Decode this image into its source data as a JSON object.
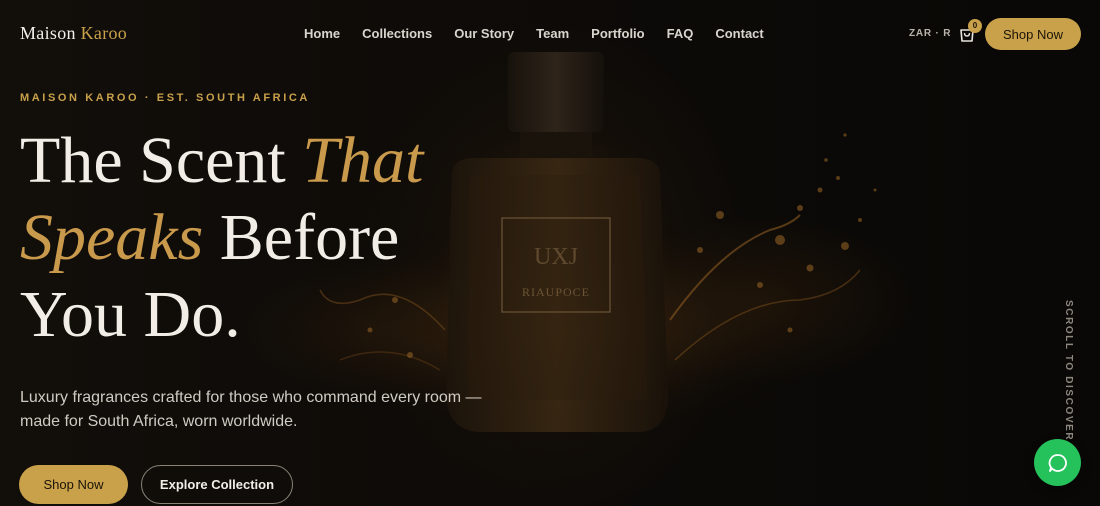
{
  "brand": {
    "name_main": "Maison",
    "name_accent": "Karoo"
  },
  "nav": {
    "links": [
      "Home",
      "Collections",
      "Our Story",
      "Team",
      "Portfolio",
      "FAQ",
      "Contact"
    ],
    "currency": "ZAR · R",
    "cart_count": "0",
    "shop_label": "Shop Now"
  },
  "hero": {
    "eyebrow": "MAISON KAROO · EST. SOUTH AFRICA",
    "headline": {
      "line1_a": "The Scent ",
      "line1_b": "That",
      "line2_a": "Speaks",
      "line2_b": " Before",
      "line3": "You Do."
    },
    "subtext": "Luxury fragrances crafted for those who command every room — made for South Africa, worn worldwide.",
    "primary_label": "Shop Now",
    "secondary_label": "Explore Collection",
    "bottle_label": "RIAUPOCE",
    "bottle_monogram": "UXJ"
  },
  "scroll_hint": "SCROLL TO DISCOVER",
  "icons": {
    "cart": "shopping-bag-icon",
    "chat": "chat-bubble-icon"
  },
  "colors": {
    "accent_gold": "#c9a14a",
    "background": "#0b0907",
    "chat_green": "#25c15a"
  }
}
